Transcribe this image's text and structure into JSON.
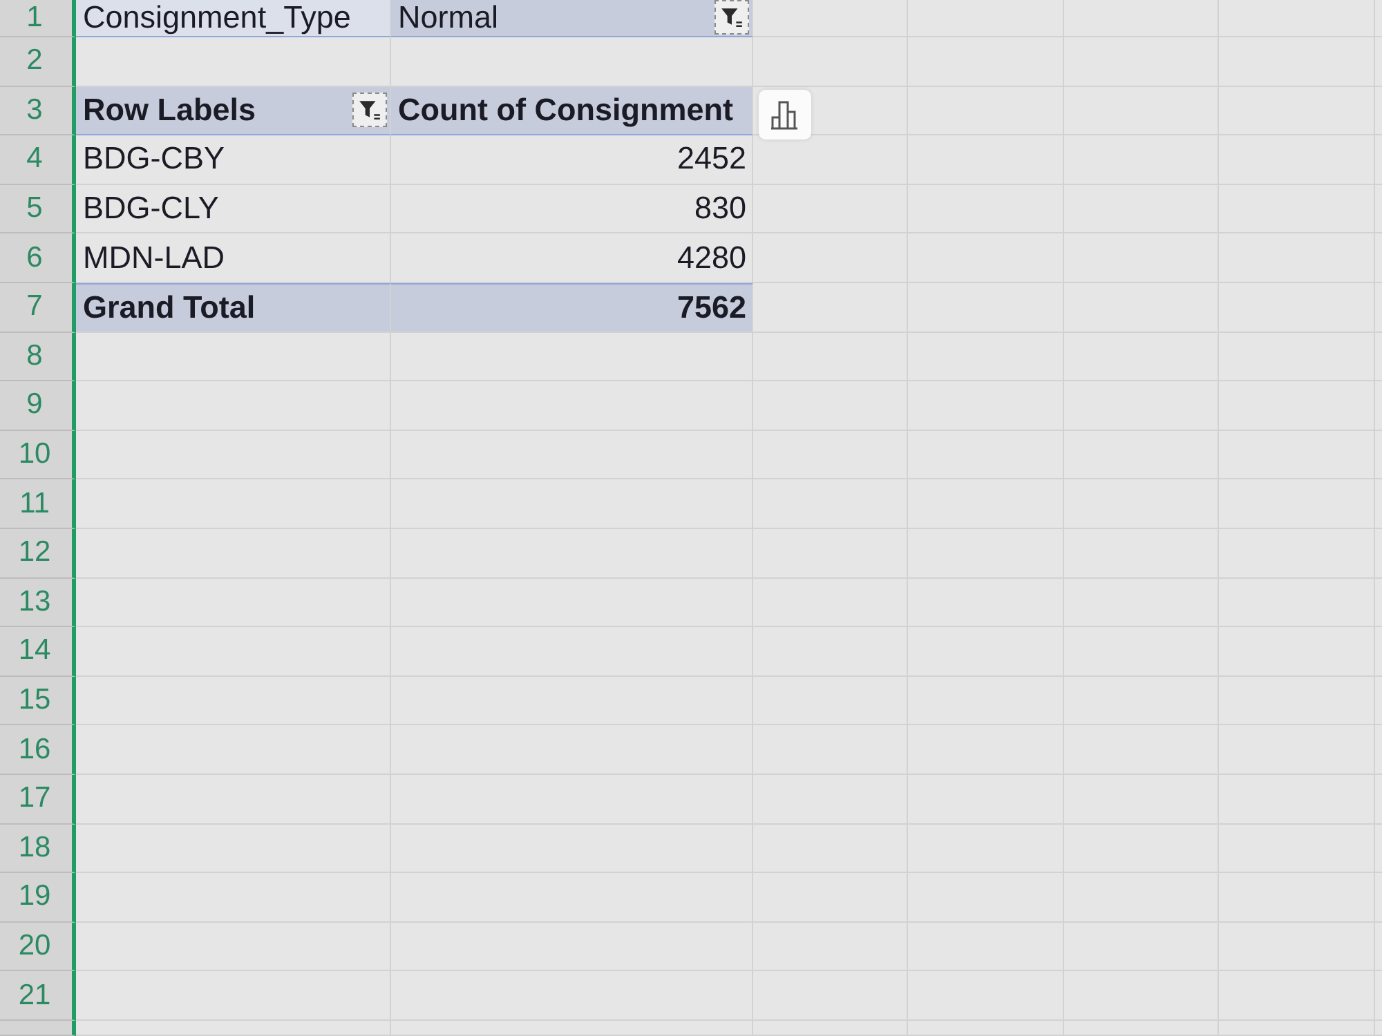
{
  "sheet": {
    "row_numbers": [
      "1",
      "2",
      "3",
      "4",
      "5",
      "6",
      "7",
      "8",
      "9",
      "10",
      "11",
      "12",
      "13",
      "14",
      "15",
      "16",
      "17",
      "18",
      "19",
      "20",
      "21"
    ]
  },
  "pivot": {
    "report_filter": {
      "field": "Consignment_Type",
      "value": "Normal",
      "filtered": true
    },
    "header": {
      "row_labels": "Row Labels",
      "row_labels_filtered": true,
      "value_field": "Count of Consignment"
    },
    "rows": [
      {
        "label": "BDG-CBY",
        "value": "2452"
      },
      {
        "label": "BDG-CLY",
        "value": "830"
      },
      {
        "label": "MDN-LAD",
        "value": "4280"
      }
    ],
    "grand_total": {
      "label": "Grand Total",
      "value": "7562"
    }
  }
}
